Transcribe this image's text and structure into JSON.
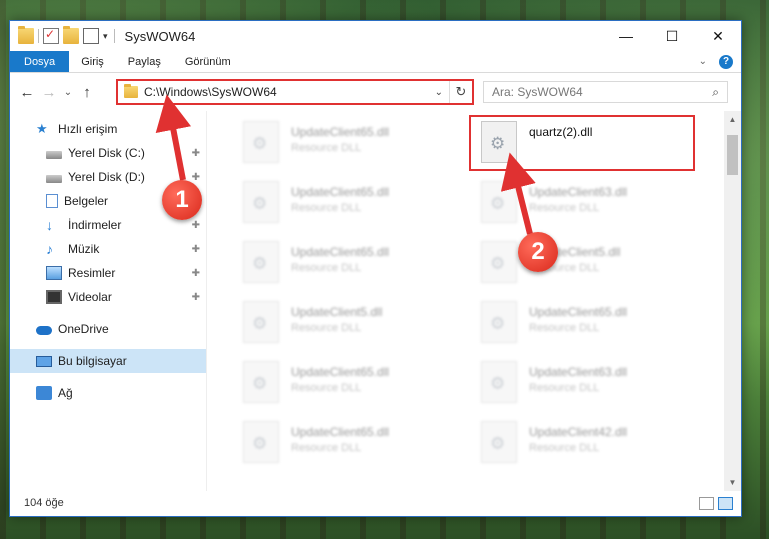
{
  "window": {
    "title": "SysWOW64",
    "controls": {
      "minimize": "—",
      "maximize": "☐",
      "close": "✕"
    }
  },
  "ribbon": {
    "tabs": [
      "Dosya",
      "Giriş",
      "Paylaş",
      "Görünüm"
    ],
    "help": "?"
  },
  "address": {
    "path": "C:\\Windows\\SysWOW64",
    "search_placeholder": "Ara: SysWOW64"
  },
  "sidebar": {
    "items": [
      {
        "label": "Hızlı erişim",
        "icon": "star-icon"
      },
      {
        "label": "Yerel Disk (C:)",
        "icon": "disk-icon",
        "pinned": true
      },
      {
        "label": "Yerel Disk (D:)",
        "icon": "disk-icon",
        "pinned": true
      },
      {
        "label": "Belgeler",
        "icon": "documents-icon",
        "pinned": true
      },
      {
        "label": "İndirmeler",
        "icon": "downloads-icon",
        "pinned": true
      },
      {
        "label": "Müzik",
        "icon": "music-icon",
        "pinned": true
      },
      {
        "label": "Resimler",
        "icon": "pictures-icon",
        "pinned": true
      },
      {
        "label": "Videolar",
        "icon": "videos-icon",
        "pinned": true
      },
      {
        "label": "OneDrive",
        "icon": "onedrive-icon"
      },
      {
        "label": "Bu bilgisayar",
        "icon": "computer-icon",
        "selected": true
      },
      {
        "label": "Ağ",
        "icon": "network-icon"
      }
    ]
  },
  "files": [
    {
      "name": "UpdateClient65.dll",
      "type": "Resource DLL"
    },
    {
      "name": "quartz(2).dll",
      "type": ""
    },
    {
      "name": "UpdateClient65.dll",
      "type": "Resource DLL"
    },
    {
      "name": "UpdateClient63.dll",
      "type": "Resource DLL"
    },
    {
      "name": "UpdateClient65.dll",
      "type": "Resource DLL"
    },
    {
      "name": "UpdateClient5.dll",
      "type": "Resource DLL"
    },
    {
      "name": "UpdateClient5.dll",
      "type": "Resource DLL"
    },
    {
      "name": "UpdateClient65.dll",
      "type": "Resource DLL"
    },
    {
      "name": "UpdateClient65.dll",
      "type": "Resource DLL"
    },
    {
      "name": "UpdateClient63.dll",
      "type": "Resource DLL"
    },
    {
      "name": "UpdateClient65.dll",
      "type": "Resource DLL"
    },
    {
      "name": "UpdateClient42.dll",
      "type": "Resource DLL"
    }
  ],
  "status": {
    "count": "104 öğe"
  },
  "annotations": {
    "marker1": "1",
    "marker2": "2",
    "color": "#e03131"
  }
}
